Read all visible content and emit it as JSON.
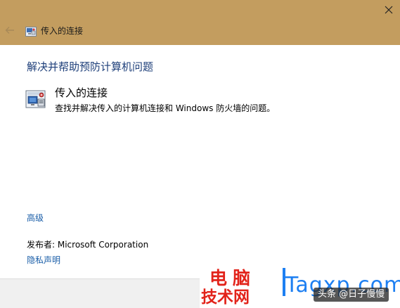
{
  "window": {
    "title": "传入的连接",
    "title_bar_color": "#c39d5f",
    "icons": {
      "close": "close-icon",
      "back": "back-arrow-icon",
      "title": "network-connection-icon"
    }
  },
  "main": {
    "heading": "解决并帮助预防计算机问题",
    "option": {
      "title": "传入的连接",
      "description": "查找并解决传入的计算机连接和 Windows 防火墙的问题。",
      "icon": "network-troubleshoot-icon"
    },
    "advanced_label": "高级",
    "publisher": "发布者:  Microsoft Corporation",
    "privacy_label": "隐私声明",
    "link_color": "#1a5ea8",
    "heading_color": "#1e3f7a"
  },
  "watermark": {
    "line1": "电脑",
    "line2": "技术网",
    "domain": "Tagxp.com",
    "attribution": "头条 @日子慢慢",
    "red": "#e2231a",
    "blue": "#1d7ff2"
  }
}
